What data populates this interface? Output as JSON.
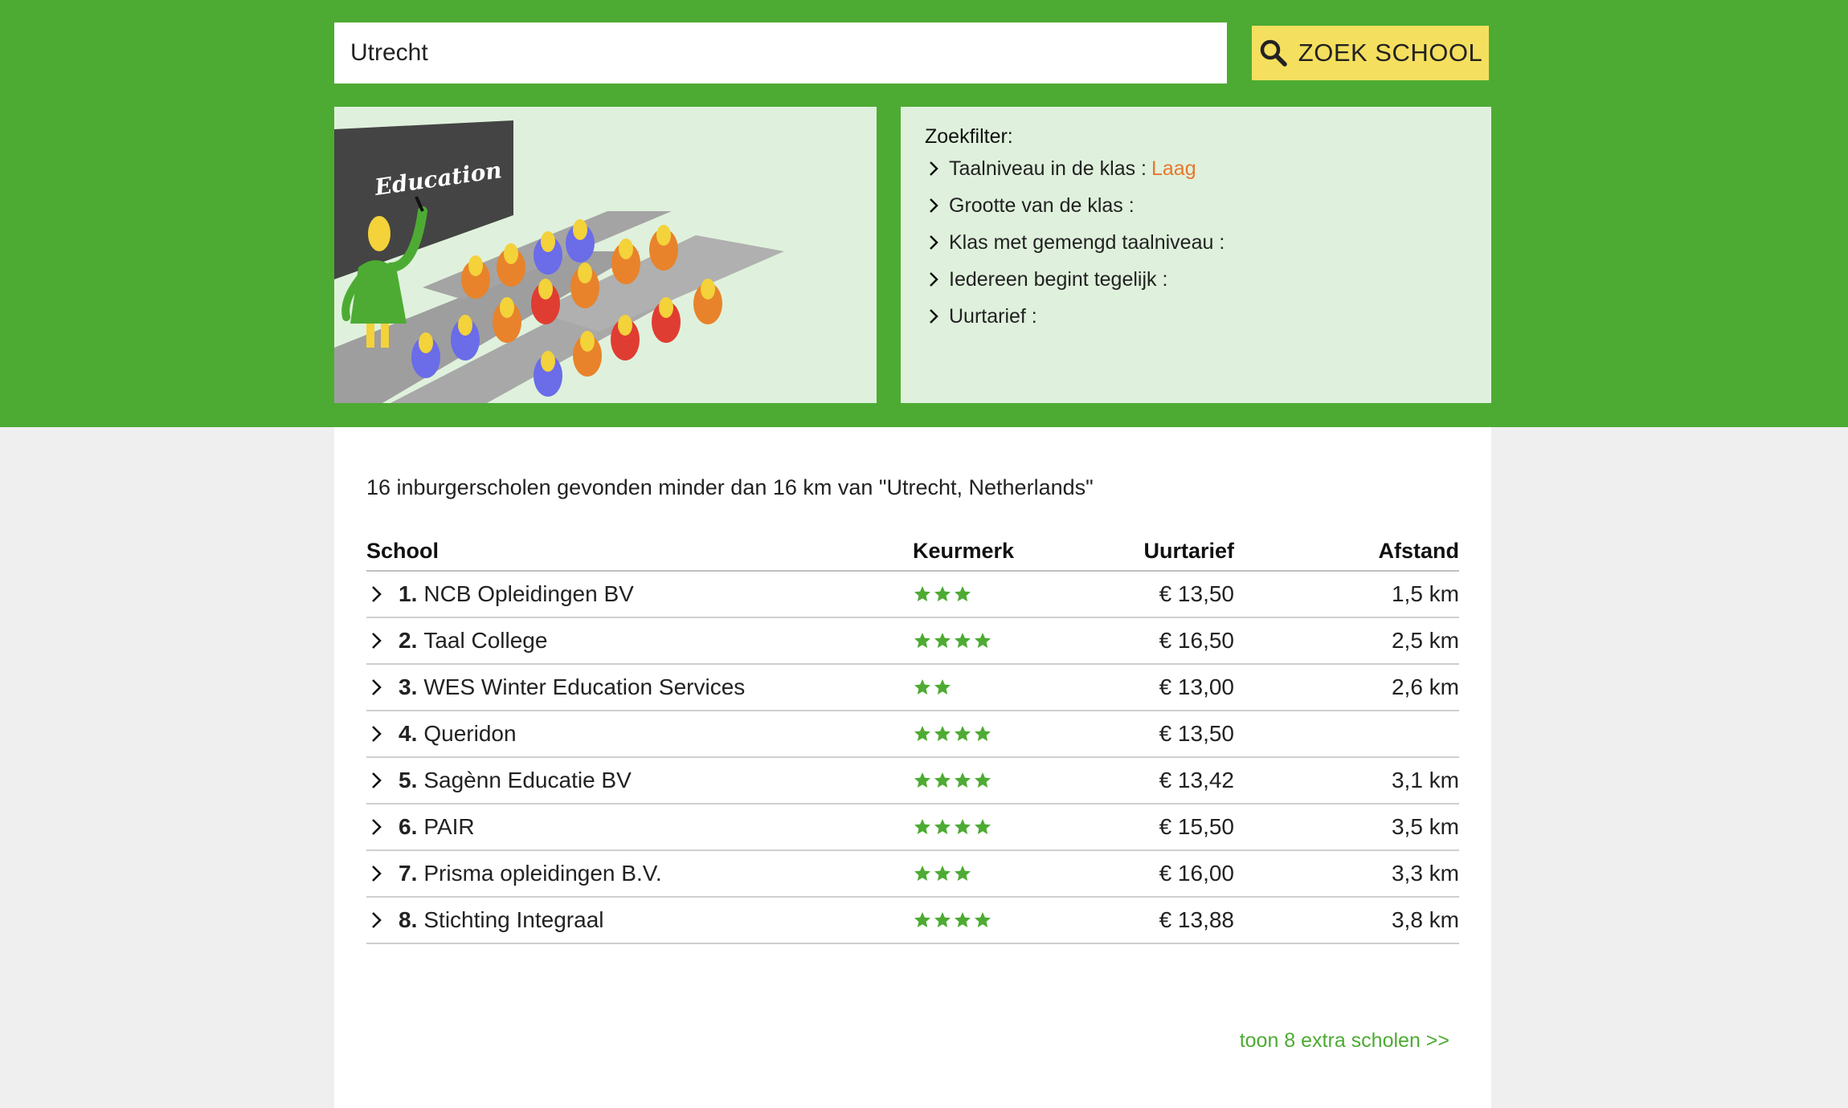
{
  "search": {
    "value": "Utrecht",
    "button_label": "ZOEK SCHOOL"
  },
  "illustration": {
    "board_text": "Education"
  },
  "filter": {
    "title": "Zoekfilter:",
    "items": [
      {
        "label": "Taalniveau in de klas :",
        "value": "Laag"
      },
      {
        "label": "Grootte van de klas :",
        "value": ""
      },
      {
        "label": "Klas met gemengd taalniveau :",
        "value": ""
      },
      {
        "label": "Iedereen begint tegelijk :",
        "value": ""
      },
      {
        "label": "Uurtarief :",
        "value": ""
      }
    ]
  },
  "results": {
    "summary": "16 inburgerscholen gevonden minder dan 16 km van \"Utrecht, Netherlands\"",
    "headers": {
      "school": "School",
      "keurmerk": "Keurmerk",
      "uurtarief": "Uurtarief",
      "afstand": "Afstand"
    },
    "rows": [
      {
        "num": "1.",
        "name": "NCB Opleidingen BV",
        "stars": 3,
        "price": "€ 13,50",
        "distance": "1,5 km"
      },
      {
        "num": "2.",
        "name": "Taal College",
        "stars": 4,
        "price": "€ 16,50",
        "distance": "2,5 km"
      },
      {
        "num": "3.",
        "name": "WES Winter Education Services",
        "stars": 2,
        "price": "€ 13,00",
        "distance": "2,6 km"
      },
      {
        "num": "4.",
        "name": "Queridon",
        "stars": 4,
        "price": "€ 13,50",
        "distance": ""
      },
      {
        "num": "5.",
        "name": "Sagènn Educatie BV",
        "stars": 4,
        "price": "€ 13,42",
        "distance": "3,1 km"
      },
      {
        "num": "6.",
        "name": "PAIR",
        "stars": 4,
        "price": "€ 15,50",
        "distance": "3,5 km"
      },
      {
        "num": "7.",
        "name": "Prisma opleidingen B.V.",
        "stars": 3,
        "price": "€ 16,00",
        "distance": "3,3 km"
      },
      {
        "num": "8.",
        "name": "Stichting Integraal",
        "stars": 4,
        "price": "€ 13,88",
        "distance": "3,8 km"
      }
    ],
    "more_link": "toon 8 extra scholen >>"
  },
  "colors": {
    "brand_green": "#4dab33",
    "panel_green": "#dff1dc",
    "button_yellow": "#f5df5e",
    "accent_orange": "#e8762b"
  }
}
